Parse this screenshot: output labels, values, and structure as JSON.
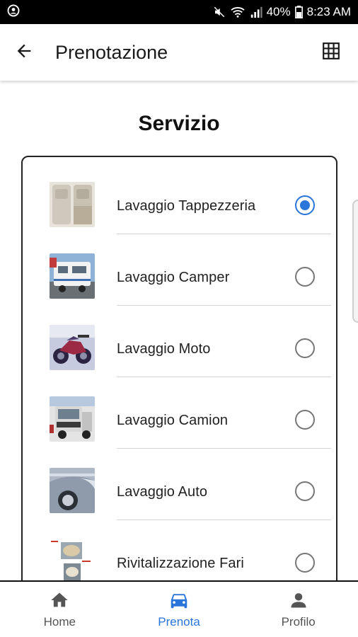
{
  "status_bar": {
    "battery": "40%",
    "time": "8:23 AM"
  },
  "app_bar": {
    "title": "Prenotazione",
    "back_icon": "arrow-back-icon",
    "grid_icon": "grid-view-icon"
  },
  "section": {
    "title": "Servizio"
  },
  "services": [
    {
      "label": "Lavaggio Tappezzeria",
      "selected": true
    },
    {
      "label": "Lavaggio Camper",
      "selected": false
    },
    {
      "label": "Lavaggio Moto",
      "selected": false
    },
    {
      "label": "Lavaggio Camion",
      "selected": false
    },
    {
      "label": "Lavaggio Auto",
      "selected": false
    },
    {
      "label": "Rivitalizzazione Fari",
      "selected": false
    }
  ],
  "bottom_nav": {
    "items": [
      {
        "label": "Home",
        "icon": "home-icon",
        "active": false
      },
      {
        "label": "Prenota",
        "icon": "car-icon",
        "active": true
      },
      {
        "label": "Profilo",
        "icon": "person-icon",
        "active": false
      }
    ]
  },
  "colors": {
    "accent": "#2a75d9",
    "text": "#1a1a1a",
    "status_bar": "#000000"
  }
}
